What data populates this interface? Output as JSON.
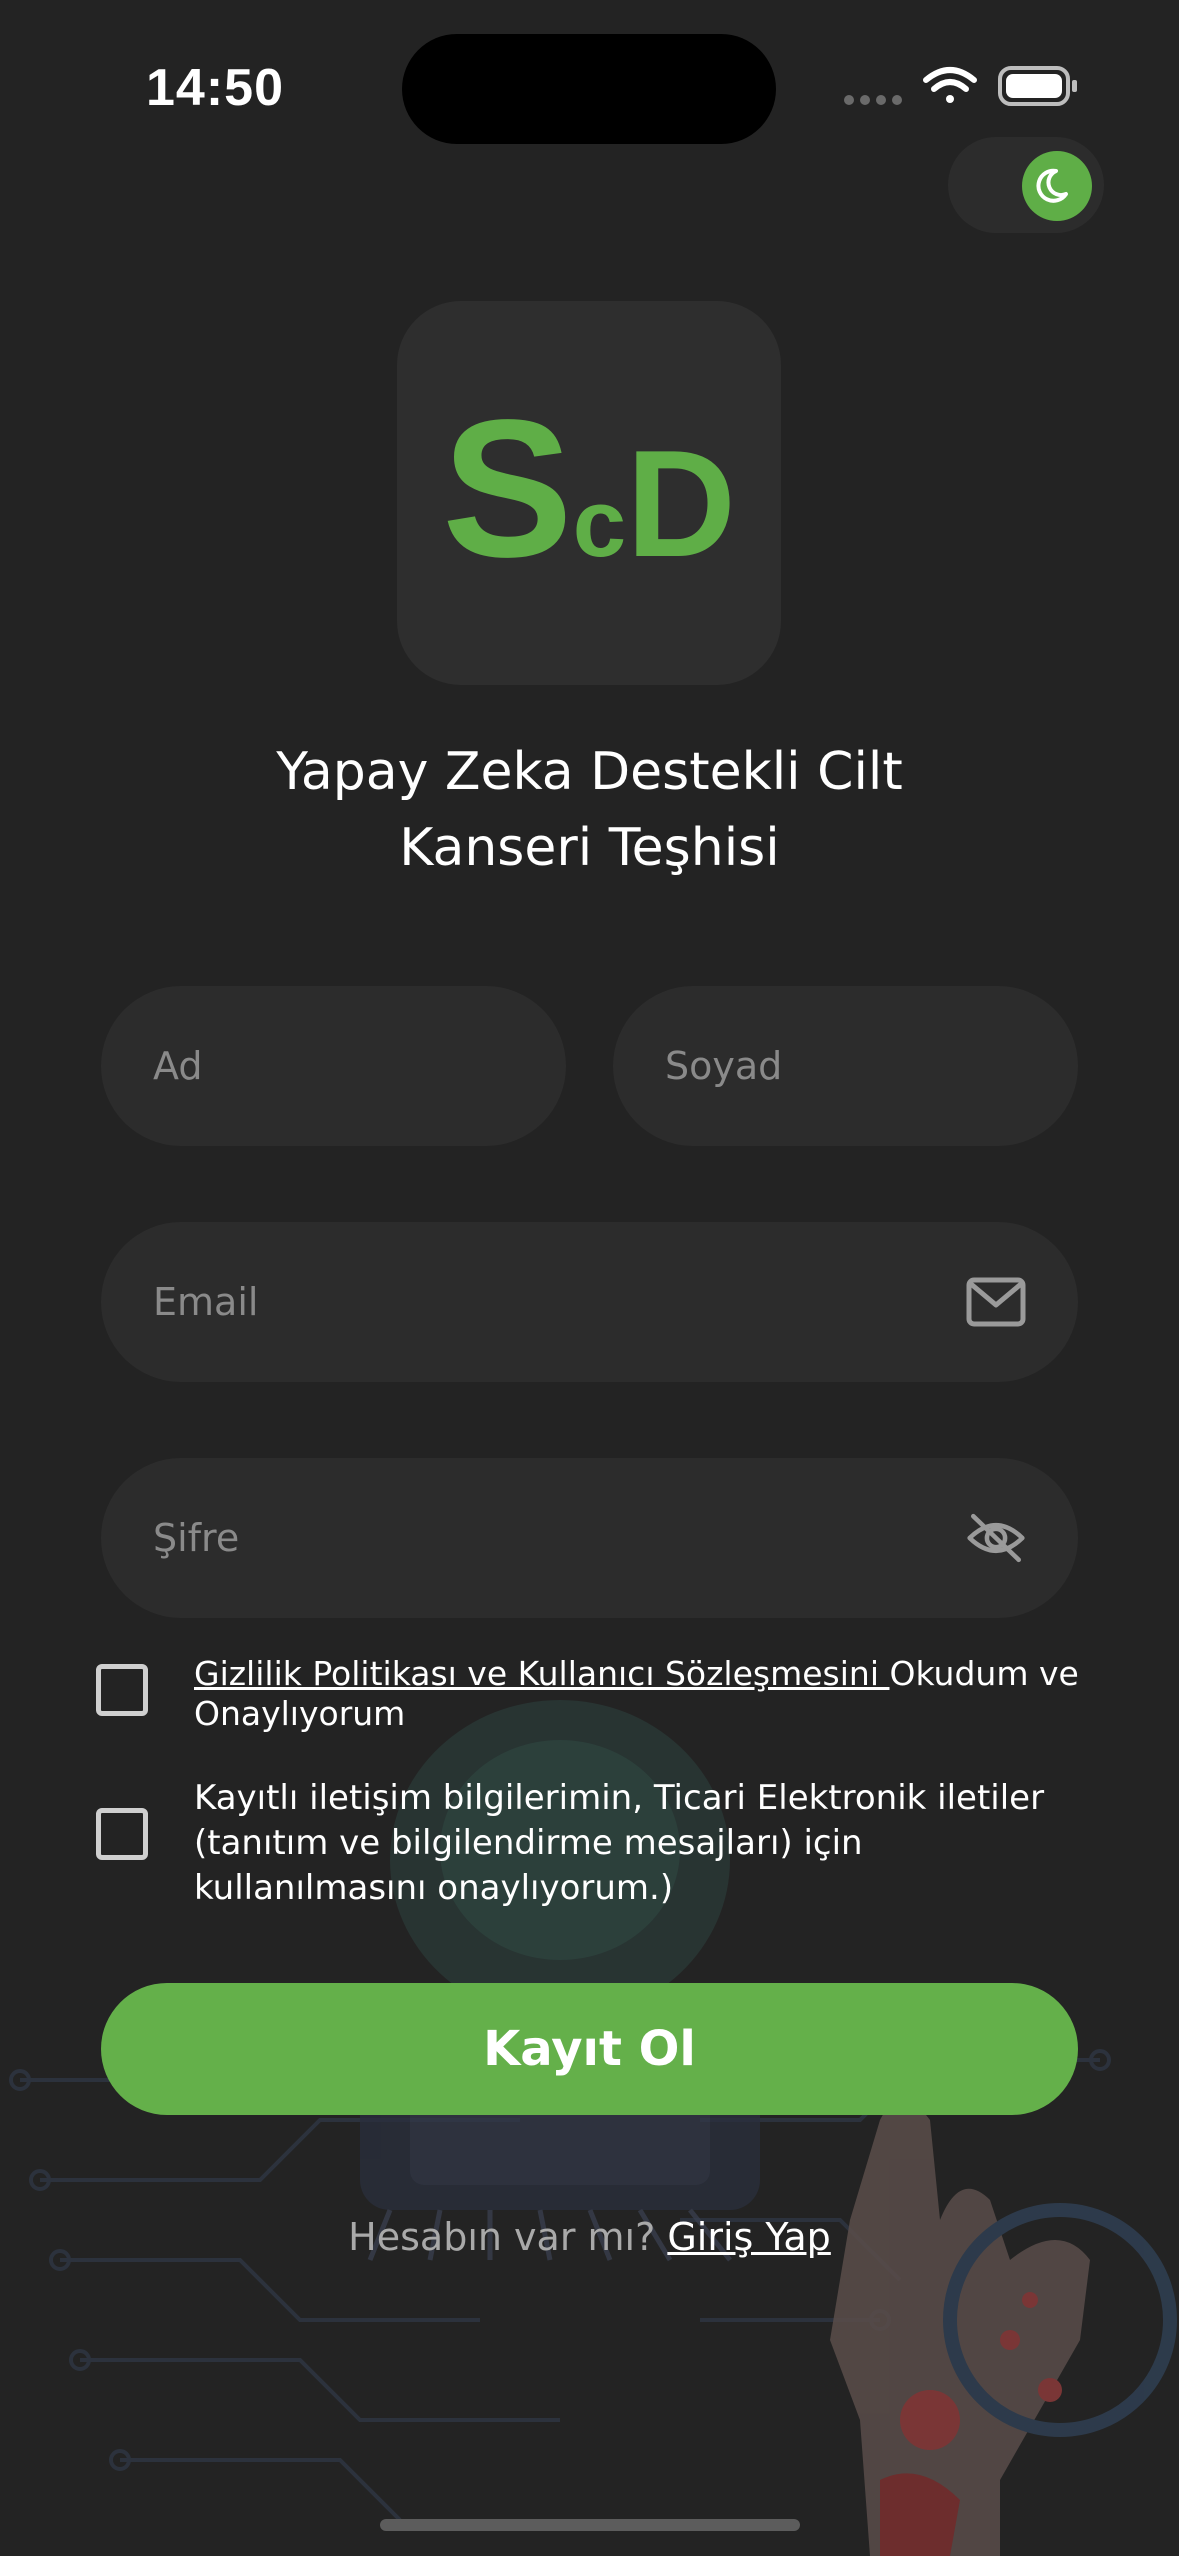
{
  "status_bar": {
    "time": "14:50"
  },
  "theme_toggle": {
    "icon": "moon-icon",
    "accent_color": "#5fae47"
  },
  "logo": {
    "letter_s": "S",
    "letter_c": "c",
    "letter_d": "D"
  },
  "title": {
    "line1": "Yapay Zeka Destekli Cilt",
    "line2": "Kanseri Teşhisi"
  },
  "form": {
    "first_name_placeholder": "Ad",
    "last_name_placeholder": "Soyad",
    "email_placeholder": "Email",
    "email_icon": "mail-icon",
    "password_placeholder": "Şifre",
    "password_icon": "eye-off-icon"
  },
  "consents": {
    "privacy_link": "Gizlilik Politikası ve Kullanıcı Sözleşmesini ",
    "privacy_rest": "Okudum ve Onaylıyorum",
    "marketing_text": "Kayıtlı iletişim bilgilerimin, Ticari Elektronik iletiler (tanıtım ve bilgilendirme mesajları) için kullanılmasını onaylıyorum.)"
  },
  "actions": {
    "register_label": "Kayıt Ol",
    "have_account": "Hesabın var mı? ",
    "login_link": "Giriş Yap",
    "primary_color": "#64b04a"
  }
}
